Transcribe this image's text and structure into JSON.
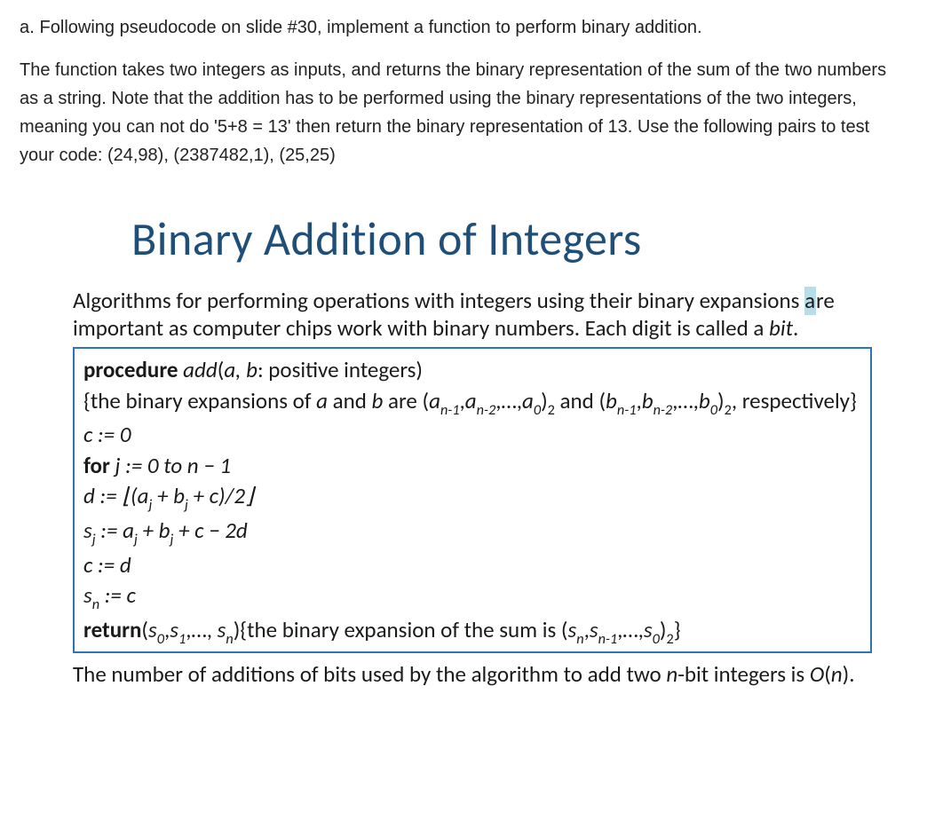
{
  "question": {
    "label": "a. ",
    "text": "Following pseudocode on slide #30, implement a function to perform binary addition."
  },
  "description": "The function takes two integers as inputs, and returns the binary representation of the sum of the two numbers as a string. Note that the addition has to be performed using the binary representations of the two integers, meaning you can not do '5+8 = 13' then return the binary representation of 13. Use the following pairs to test your code: (24,98), (2387482,1), (25,25)",
  "slide": {
    "title": "Binary Addition of Integers",
    "intro_pre": "Algorithms for performing operations with integers using their binary expansions ",
    "intro_hl_prefix": "a",
    "intro_hl_rest": "re",
    "intro_post": " important as computer chips work with binary numbers. Each digit is called a ",
    "intro_bit": "bit",
    "intro_end": ".",
    "algo": {
      "proc_kw": "procedure ",
      "proc_name": "add",
      "proc_sig_open": "(",
      "proc_args": "a, b",
      "proc_sig_rest": ": positive integers)",
      "comment_open": "{the binary expansions of ",
      "comment_a": "a",
      "comment_mid1": " and ",
      "comment_b": "b",
      "comment_mid2": " are (",
      "a_n1": "a",
      "sub_n1": "n-1",
      "comma1": ",",
      "a_n2": "a",
      "sub_n2": "n-2",
      "comma_dots1": ",…,",
      "a_0": "a",
      "sub_0": "0",
      "close_paren1": ")",
      "base2a": "2",
      "and_text": "  and (",
      "b_n1": "b",
      "b_n2": "b",
      "b_0": "b",
      "close_paren2": ")",
      "base2b": "2",
      "comma_end": ",",
      "respectively": " respectively}",
      "c_init": "c := 0",
      "for_kw": "for",
      "for_rest": "  j := 0 to n − 1",
      "d_line_pre": "d := ⌊(",
      "d_line_aj": "a",
      "d_line_sub_j1": "j",
      "d_line_mid1": " + ",
      "d_line_bj": "b",
      "d_line_sub_j2": "j",
      "d_line_post": " + c)/2⌋",
      "s_line_s": "s",
      "s_line_subj": "j",
      "s_line_mid": " := ",
      "s_line_aj": "a",
      "s_line_plus": " + ",
      "s_line_bj": "b",
      "s_line_post": " + c − 2d",
      "c_d": "c := d",
      "sn_s": "s",
      "sn_sub": "n",
      "sn_rest": " := c",
      "ret_kw": "return",
      "ret_open": "(",
      "ret_s0": "s",
      "ret_sub0": "0",
      "ret_c1": ",",
      "ret_s1": "s",
      "ret_sub1": "1",
      "ret_dots": ",…, ",
      "ret_sn": "s",
      "ret_subn": "n",
      "ret_close": ")",
      "ret_comment_pre": "{the binary expansion of the sum is (",
      "ret_sna": "s",
      "ret_subna": "n",
      "ret_cma": ",",
      "ret_sn1": "s",
      "ret_subn1": "n-1",
      "ret_dots2": ",…,",
      "ret_s0b": "s",
      "ret_sub0b": "0",
      "ret_close2": ")",
      "ret_base2": "2",
      "ret_brace": "}"
    },
    "complexity_pre": "The number of additions of bits used by the algorithm to add two ",
    "complexity_n": "n",
    "complexity_mid": "-bit integers is ",
    "complexity_O": "O",
    "complexity_paren": "(",
    "complexity_n2": "n",
    "complexity_end": ")."
  }
}
